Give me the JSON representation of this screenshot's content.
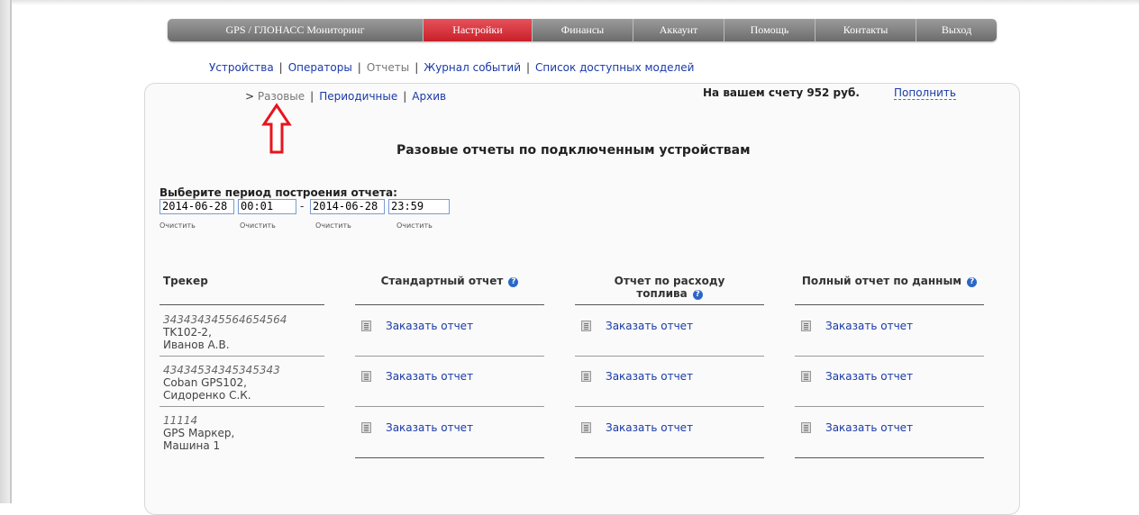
{
  "nav": {
    "items": [
      {
        "label": "GPS / ГЛОНАСС Мониторинг",
        "active": false
      },
      {
        "label": "Настройки",
        "active": true
      },
      {
        "label": "Финансы",
        "active": false
      },
      {
        "label": "Аккаунт",
        "active": false
      },
      {
        "label": "Помощь",
        "active": false
      },
      {
        "label": "Контакты",
        "active": false
      },
      {
        "label": "Выход",
        "active": false
      }
    ],
    "active_color": "#d9303a"
  },
  "subnav": {
    "items": [
      "Устройства",
      "Операторы",
      "Отчеты",
      "Журнал событий",
      "Список доступных моделей"
    ],
    "separator": "|",
    "current": "Отчеты"
  },
  "tabs": {
    "prefix": ">",
    "items": [
      "Разовые",
      "Периодичные",
      "Архив"
    ],
    "current": "Разовые"
  },
  "balance": {
    "text": "На вашем счету 952 руб.",
    "topup_label": "Пополнить"
  },
  "page_title": "Разовые отчеты по подключенным устройствам",
  "period": {
    "label": "Выберите период построения отчета:",
    "from_date": "2014-06-28",
    "from_time": "00:01",
    "dash": "-",
    "to_date": "2014-06-28",
    "to_time": "23:59",
    "clear_label": "Очистить"
  },
  "table": {
    "headers": {
      "tracker": "Трекер",
      "standard": "Стандартный отчет",
      "fuel_line1": "Отчет по расходу",
      "fuel_line2": "топлива",
      "full": "Полный отчет по данным"
    },
    "help_icon": "?",
    "rows": [
      {
        "id": "343434345564654564",
        "model": "TK102-2,",
        "owner": "Иванов А.В."
      },
      {
        "id": "43434534345345343",
        "model": "Coban GPS102,",
        "owner": "Сидоренко С.К."
      },
      {
        "id": "11114",
        "model": "GPS Маркер,",
        "owner": "Машина 1"
      }
    ],
    "action_label": "Заказать отчет",
    "action_icon": "document-icon"
  },
  "annotation": {
    "icon": "up-arrow-icon",
    "color": "#e8141e"
  }
}
